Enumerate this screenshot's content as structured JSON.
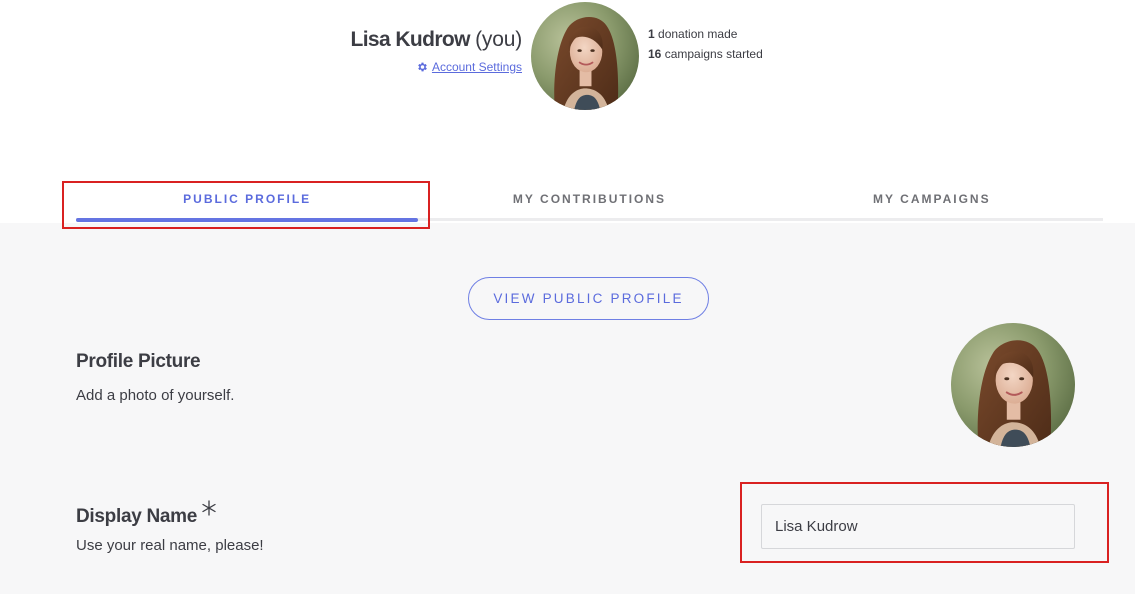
{
  "profile": {
    "name": "Lisa Kudrow",
    "you_label": "(you)",
    "account_settings_label": "Account Settings",
    "account_settings_icon": "gear-icon",
    "stats": {
      "donations_count": "1",
      "donations_label": "donation made",
      "campaigns_count": "16",
      "campaigns_label": "campaigns started"
    }
  },
  "tabs": [
    {
      "label": "PUBLIC PROFILE",
      "active": true
    },
    {
      "label": "MY CONTRIBUTIONS",
      "active": false
    },
    {
      "label": "MY CAMPAIGNS",
      "active": false
    }
  ],
  "public_profile": {
    "view_button_label": "VIEW PUBLIC PROFILE",
    "profile_picture": {
      "title": "Profile Picture",
      "description": "Add a photo of yourself."
    },
    "display_name": {
      "title": "Display Name",
      "required_marker_icon": "asterisk-icon",
      "description": "Use your real name, please!",
      "value": "Lisa Kudrow"
    }
  },
  "colors": {
    "accent": "#5b6bdd",
    "active_tab_bar": "#6474e2",
    "text": "#3c3d44",
    "muted_text": "#6f7075",
    "panel_bg": "#f7f7f8",
    "annotation_red": "#d92121"
  }
}
